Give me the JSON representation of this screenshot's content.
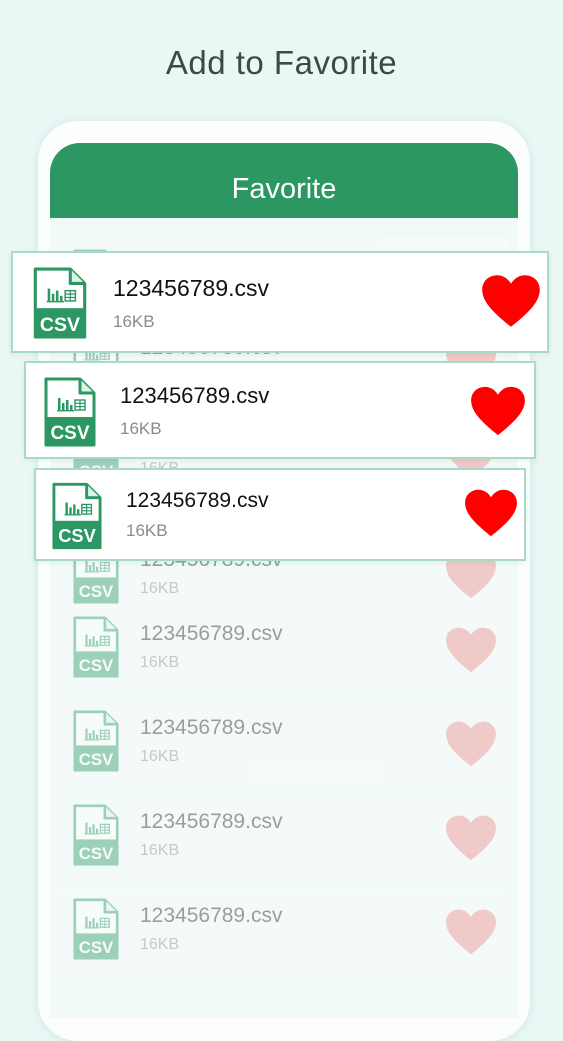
{
  "headline": "Add to Favorite",
  "appbar": {
    "title": "Favorite"
  },
  "colors": {
    "background": "#e9f7f5",
    "appbar": "#2c9763",
    "icon_green": "#2c9763",
    "heart_active": "#ff0000",
    "heart_faded": "#f08a8a",
    "card_border": "#a8dbc7"
  },
  "file_icon": "csv-file-icon",
  "heart_icon": "heart-icon",
  "highlighted_files": [
    {
      "name": "123456789.csv",
      "size": "16KB",
      "icon_label": "CSV"
    },
    {
      "name": "123456789.csv",
      "size": "16KB",
      "icon_label": "CSV"
    },
    {
      "name": "123456789.csv",
      "size": "16KB",
      "icon_label": "CSV"
    }
  ],
  "background_files": [
    {
      "name": "123456789.csv",
      "size": "16KB",
      "icon_label": "CSV"
    },
    {
      "name": "123456789.csv",
      "size": "16KB",
      "icon_label": "CSV"
    },
    {
      "name": "123456789.csv",
      "size": "16KB",
      "icon_label": "CSV"
    },
    {
      "name": "123456789.csv",
      "size": "16KB",
      "icon_label": "CSV"
    },
    {
      "name": "123456789.csv",
      "size": "16KB",
      "icon_label": "CSV"
    },
    {
      "name": "123456789.csv",
      "size": "16KB",
      "icon_label": "CSV"
    },
    {
      "name": "123456789.csv",
      "size": "16KB",
      "icon_label": "CSV"
    },
    {
      "name": "123456789.csv",
      "size": "16KB",
      "icon_label": "CSV"
    }
  ]
}
